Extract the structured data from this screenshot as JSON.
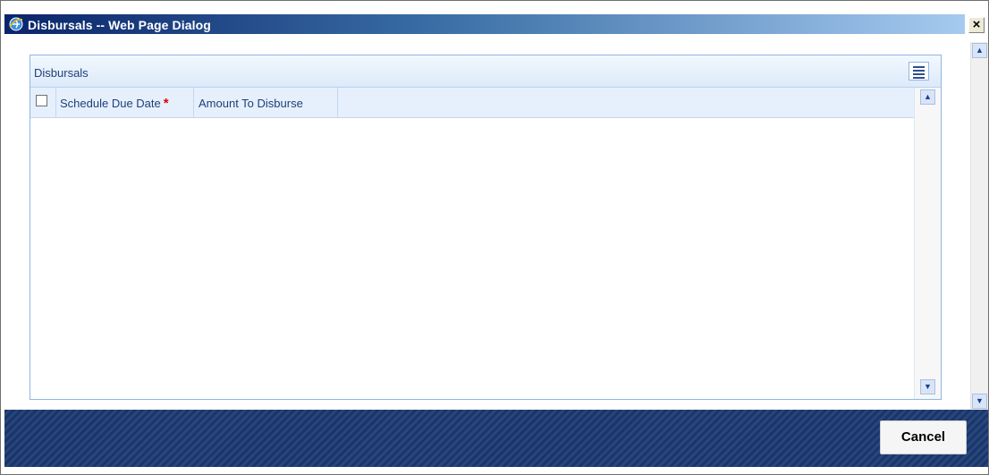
{
  "window": {
    "title": "Disbursals -- Web Page Dialog",
    "close_label": "×"
  },
  "panel": {
    "title": "Disbursals",
    "columns": [
      {
        "label": "Schedule Due Date",
        "required_mark": "*"
      },
      {
        "label": "Amount To Disburse"
      }
    ],
    "rows": []
  },
  "footer": {
    "cancel_label": "Cancel"
  },
  "colors": {
    "title_gradient_start": "#0a246a",
    "title_gradient_end": "#a6caf0",
    "panel_border": "#8fb6e4",
    "header_text": "#1d3f7a",
    "required": "#e00000",
    "footer_bg": "#1b3568"
  },
  "icons": {
    "title": "ie-icon",
    "panel_action": "list-icon",
    "scroll_up": "up-arrow-icon",
    "scroll_down": "down-arrow-icon"
  }
}
